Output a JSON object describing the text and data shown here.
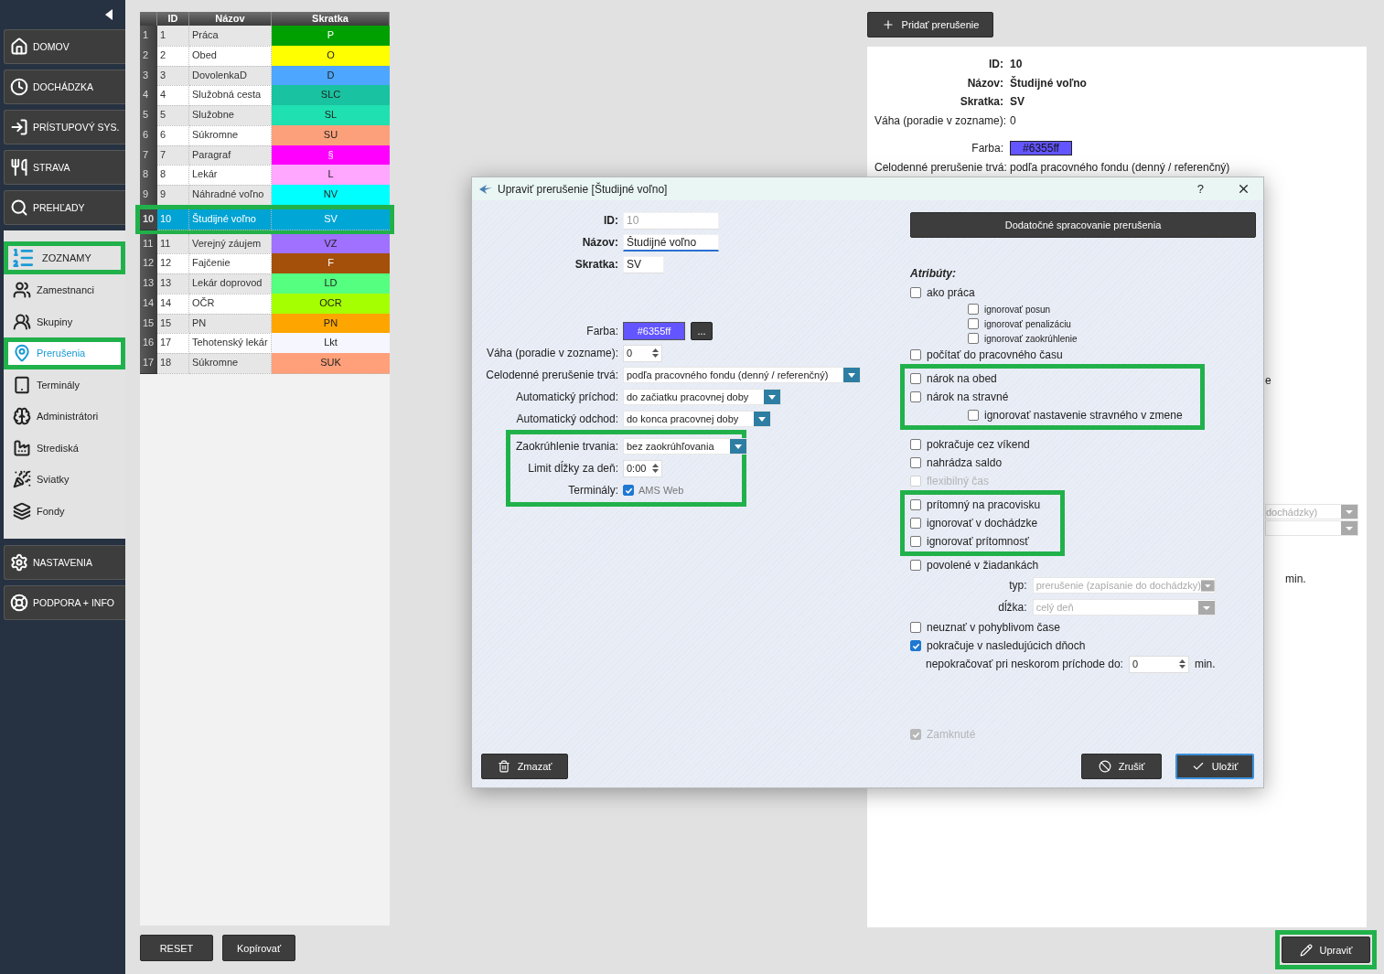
{
  "sidebar": {
    "items": [
      {
        "kind": "button",
        "label": "DOMOV",
        "highlighted": false
      },
      {
        "kind": "button",
        "label": "DOCHÁDZKA",
        "highlighted": false
      },
      {
        "kind": "button",
        "label": "PRÍSTUPOVÝ SYS.",
        "highlighted": false
      },
      {
        "kind": "button",
        "label": "STRAVA",
        "highlighted": false
      },
      {
        "kind": "button",
        "label": "PREHĽADY",
        "highlighted": false
      },
      {
        "kind": "section",
        "label": "ZOZNAMY",
        "highlighted": true,
        "children": [
          {
            "label": "Zamestnanci",
            "selected": false,
            "highlighted": false
          },
          {
            "label": "Skupiny",
            "selected": false,
            "highlighted": false
          },
          {
            "label": "Prerušenia",
            "selected": true,
            "highlighted": true
          },
          {
            "label": "Terminály",
            "selected": false,
            "highlighted": false
          },
          {
            "label": "Administrátori",
            "selected": false,
            "highlighted": false
          },
          {
            "label": "Strediská",
            "selected": false,
            "highlighted": false
          },
          {
            "label": "Sviatky",
            "selected": false,
            "highlighted": false
          },
          {
            "label": "Fondy",
            "selected": false,
            "highlighted": false
          }
        ]
      },
      {
        "kind": "button",
        "label": "NASTAVENIA",
        "highlighted": false
      },
      {
        "kind": "button",
        "label": "PODPORA + INFO",
        "highlighted": false
      }
    ]
  },
  "table": {
    "columns": [
      "ID",
      "Názov",
      "Skratka"
    ],
    "rows": [
      {
        "number": "1",
        "id": "1",
        "name": "Práca",
        "code": "P",
        "color": "#00a000",
        "selected": false,
        "highlighted": false
      },
      {
        "number": "2",
        "id": "2",
        "name": "Obed",
        "code": "O",
        "color": "#ffff00",
        "selected": false,
        "highlighted": false
      },
      {
        "number": "3",
        "id": "3",
        "name": "DovolenkaD",
        "code": "D",
        "color": "#4da6ff",
        "selected": false,
        "highlighted": false
      },
      {
        "number": "4",
        "id": "4",
        "name": "Služobná cesta",
        "code": "SLC",
        "color": "#19c2a0",
        "selected": false,
        "highlighted": false
      },
      {
        "number": "5",
        "id": "5",
        "name": "Služobne",
        "code": "SL",
        "color": "#1fe0b0",
        "selected": false,
        "highlighted": false
      },
      {
        "number": "6",
        "id": "6",
        "name": "Súkromne",
        "code": "SU",
        "color": "#fca07c",
        "selected": false,
        "highlighted": false
      },
      {
        "number": "7",
        "id": "7",
        "name": "Paragraf",
        "code": "§",
        "color": "#ff00ff",
        "selected": false,
        "highlighted": false
      },
      {
        "number": "8",
        "id": "8",
        "name": "Lekár",
        "code": "L",
        "color": "#ffa6ff",
        "selected": false,
        "highlighted": false
      },
      {
        "number": "9",
        "id": "9",
        "name": "Náhradné voľno",
        "code": "NV",
        "color": "#00ffff",
        "selected": false,
        "highlighted": false
      },
      {
        "number": "10",
        "id": "10",
        "name": "Študijné voľno",
        "code": "SV",
        "selected": true,
        "highlighted": true
      },
      {
        "number": "11",
        "id": "11",
        "name": "Verejný záujem",
        "code": "VZ",
        "color": "#a070ff",
        "selected": false,
        "highlighted": false
      },
      {
        "number": "12",
        "id": "12",
        "name": "Fajčenie",
        "code": "F",
        "color": "#a4500a",
        "selected": false,
        "highlighted": false
      },
      {
        "number": "13",
        "id": "13",
        "name": "Lekár doprovod",
        "code": "LD",
        "color": "#55ff80",
        "selected": false,
        "highlighted": false
      },
      {
        "number": "14",
        "id": "14",
        "name": "OČR",
        "code": "OCR",
        "color": "#a6ff00",
        "selected": false,
        "highlighted": false
      },
      {
        "number": "15",
        "id": "15",
        "name": "PN",
        "code": "PN",
        "color": "#ffa500",
        "selected": false,
        "highlighted": false
      },
      {
        "number": "16",
        "id": "17",
        "name": "Tehotenský lekár",
        "code": "Lkt",
        "color": "#f6f6ff",
        "selected": false,
        "highlighted": false
      },
      {
        "number": "17",
        "id": "18",
        "name": "Súkromne",
        "code": "SUK",
        "color": "#ffa07a",
        "selected": false,
        "highlighted": false
      }
    ]
  },
  "table_buttons": [
    {
      "label": "RESET"
    },
    {
      "label": "Kopírovať"
    }
  ],
  "add_button": {
    "label": "Pridať prerušenie"
  },
  "detail": {
    "fields": [
      {
        "kind": "bold",
        "label": "ID:",
        "value": "10"
      },
      {
        "kind": "bold",
        "label": "Názov:",
        "value": "Študijné voľno"
      },
      {
        "kind": "bold",
        "label": "Skratka:",
        "value": "SV"
      },
      {
        "kind": "plain",
        "label": "Váha (poradie v zozname):",
        "value": "0"
      },
      {
        "kind": "color",
        "label": "Farba:",
        "value": "#6355ff",
        "color": "#6355ff"
      },
      {
        "kind": "plain",
        "label": "Celodenné prerušenie trvá:",
        "value": "podľa pracovného fondu (denný / referenčný)"
      }
    ],
    "peek": [
      {
        "kind": "text",
        "text": "e"
      },
      {
        "kind": "select",
        "value": "dochádzky)"
      },
      {
        "kind": "select"
      },
      {
        "kind": "text",
        "text": "min."
      }
    ]
  },
  "edit_button": {
    "label": "Upraviť",
    "highlighted": true
  },
  "dialog": {
    "title": "Upraviť prerušenie [Študijné voľno]",
    "help": "?",
    "groups": [
      {
        "highlighted": false,
        "fields": [
          {
            "kind": "input",
            "label": "ID:",
            "strong": true,
            "value": "10",
            "disabled": true,
            "focused": false
          },
          {
            "kind": "input",
            "label": "Názov:",
            "strong": true,
            "value": "Študijné voľno",
            "disabled": false,
            "focused": true
          },
          {
            "kind": "input",
            "label": "Skratka:",
            "strong": true,
            "value": "SV",
            "disabled": false,
            "focused": false
          }
        ]
      },
      {
        "highlighted": false,
        "fields": [
          {
            "kind": "color",
            "label": "Farba:",
            "strong": false,
            "value": "#6355ff",
            "color": "#6355ff",
            "picker": "..."
          },
          {
            "kind": "spinner",
            "label": "Váha (poradie v zozname):",
            "strong": false,
            "value": "0"
          },
          {
            "kind": "select",
            "label": "Celodenné prerušenie trvá:",
            "strong": false,
            "value": "podľa pracovného fondu (denný / referenčný)"
          },
          {
            "kind": "select",
            "label": "Automatický príchod:",
            "strong": false,
            "value": "do začiatku pracovnej doby"
          },
          {
            "kind": "select",
            "label": "Automatický odchod:",
            "strong": false,
            "value": "do konca pracovnej doby"
          }
        ]
      },
      {
        "highlighted": true,
        "fields": [
          {
            "kind": "select",
            "label": "Zaokrúhlenie trvania:",
            "strong": false,
            "value": "bez zaokrúhľovania"
          },
          {
            "kind": "spinner",
            "label": "Limit dĺžky za deň:",
            "strong": false,
            "value": "0:00"
          },
          {
            "kind": "checkbox",
            "label": "Terminály:",
            "strong": false,
            "option": "AMS Web",
            "checked": true
          }
        ]
      }
    ],
    "extra_button": "Dodatočné spracovanie prerušenia",
    "attributes_title": "Atribúty:",
    "attribute_groups": [
      {
        "highlighted": false,
        "items": [
          {
            "kind": "checkbox",
            "label": "ako práca",
            "checked": false,
            "disabled": false,
            "children": [
              {
                "kind": "checkbox",
                "label": "ignorovať posun",
                "checked": false,
                "disabled": false,
                "small": true
              },
              {
                "kind": "checkbox",
                "label": "ignorovať penalizáciu",
                "checked": false,
                "disabled": false,
                "small": true
              },
              {
                "kind": "checkbox",
                "label": "ignorovať zaokrúhlenie",
                "checked": false,
                "disabled": false,
                "small": true
              }
            ]
          },
          {
            "kind": "checkbox",
            "label": "počítať do pracovného času",
            "checked": false,
            "disabled": false
          }
        ]
      },
      {
        "highlighted": true,
        "items": [
          {
            "kind": "checkbox",
            "label": "nárok na obed",
            "checked": false,
            "disabled": false
          },
          {
            "kind": "checkbox",
            "label": "nárok na stravné",
            "checked": false,
            "disabled": false,
            "children": [
              {
                "kind": "checkbox",
                "label": "ignorovať nastavenie stravného v zmene",
                "checked": false,
                "disabled": false,
                "small": false
              }
            ]
          }
        ]
      },
      {
        "highlighted": false,
        "items": [
          {
            "kind": "checkbox",
            "label": "pokračuje cez víkend",
            "checked": false,
            "disabled": false
          },
          {
            "kind": "checkbox",
            "label": "nahrádza saldo",
            "checked": false,
            "disabled": false
          },
          {
            "kind": "checkbox",
            "label": "flexibilný čas",
            "checked": false,
            "disabled": true
          }
        ]
      },
      {
        "highlighted": true,
        "items": [
          {
            "kind": "checkbox",
            "label": "prítomný na pracovisku",
            "checked": false,
            "disabled": false
          },
          {
            "kind": "checkbox",
            "label": "ignorovať v dochádzke",
            "checked": false,
            "disabled": false
          },
          {
            "kind": "checkbox",
            "label": "ignorovať prítomnosť",
            "checked": false,
            "disabled": false
          }
        ]
      },
      {
        "highlighted": false,
        "items": [
          {
            "kind": "checkbox",
            "label": "povolené v žiadankách",
            "checked": false,
            "disabled": false,
            "children": [
              {
                "kind": "select",
                "label": "typ:",
                "value": "prerušenie (zapísanie do dochádzky)",
                "disabled": true
              },
              {
                "kind": "select",
                "label": "dĺžka:",
                "value": "celý deň",
                "disabled": true
              }
            ]
          },
          {
            "kind": "checkbox",
            "label": "neuznať v pohyblivom čase",
            "checked": false,
            "disabled": false
          },
          {
            "kind": "checkbox",
            "label": "pokračuje v nasledujúcich dňoch",
            "checked": true,
            "disabled": false,
            "children": [
              {
                "kind": "spinner",
                "label": "nepokračovať pri neskorom príchode do:",
                "value": "0",
                "unit": "min."
              }
            ]
          }
        ]
      }
    ],
    "locked": {
      "label": "Zamknuté",
      "checked": true,
      "disabled": true
    },
    "footer": {
      "delete": "Zmazať",
      "cancel": "Zrušiť",
      "save": "Uložiť"
    }
  }
}
